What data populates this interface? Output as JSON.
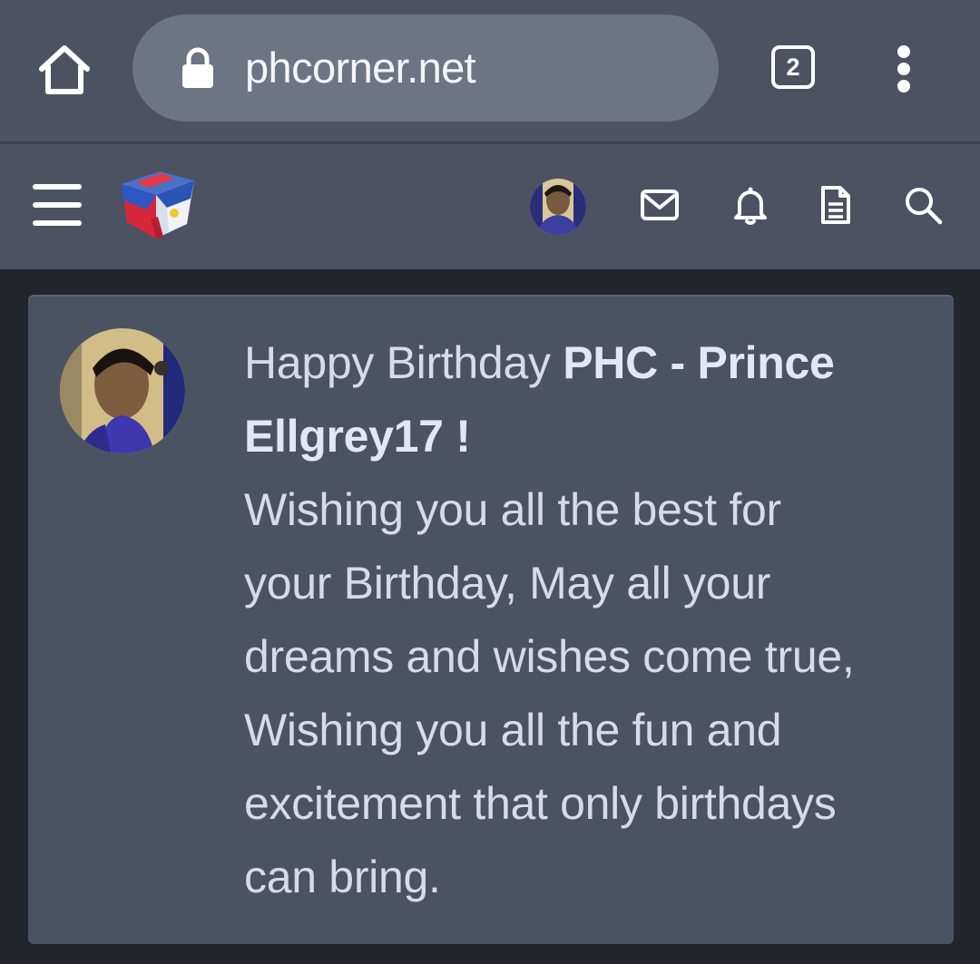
{
  "browser": {
    "url": "phcorner.net",
    "tab_count": "2",
    "icons": [
      "home-icon",
      "lock-icon",
      "tab-switcher-icon",
      "more-vert-icon"
    ]
  },
  "site_nav": {
    "icons": [
      "menu-icon",
      "site-logo",
      "user-avatar",
      "mail-icon",
      "bell-icon",
      "document-icon",
      "search-icon"
    ]
  },
  "post": {
    "greeting": "Happy Birthday",
    "name": "PHC - Prince Ellgrey17 !",
    "line1": "Wishing you all the best for",
    "line2": "your Birthday, May all your",
    "line3": "dreams and wishes come true,",
    "line4": "Wishing you all the fun and",
    "line5": "excitement that only birthdays",
    "line6": "can bring."
  },
  "colors": {
    "chrome": "#4c5262",
    "url_pill": "#6d7482",
    "page_bg": "#22252b",
    "card_bg": "#4b5262",
    "text": "#d7daed"
  }
}
